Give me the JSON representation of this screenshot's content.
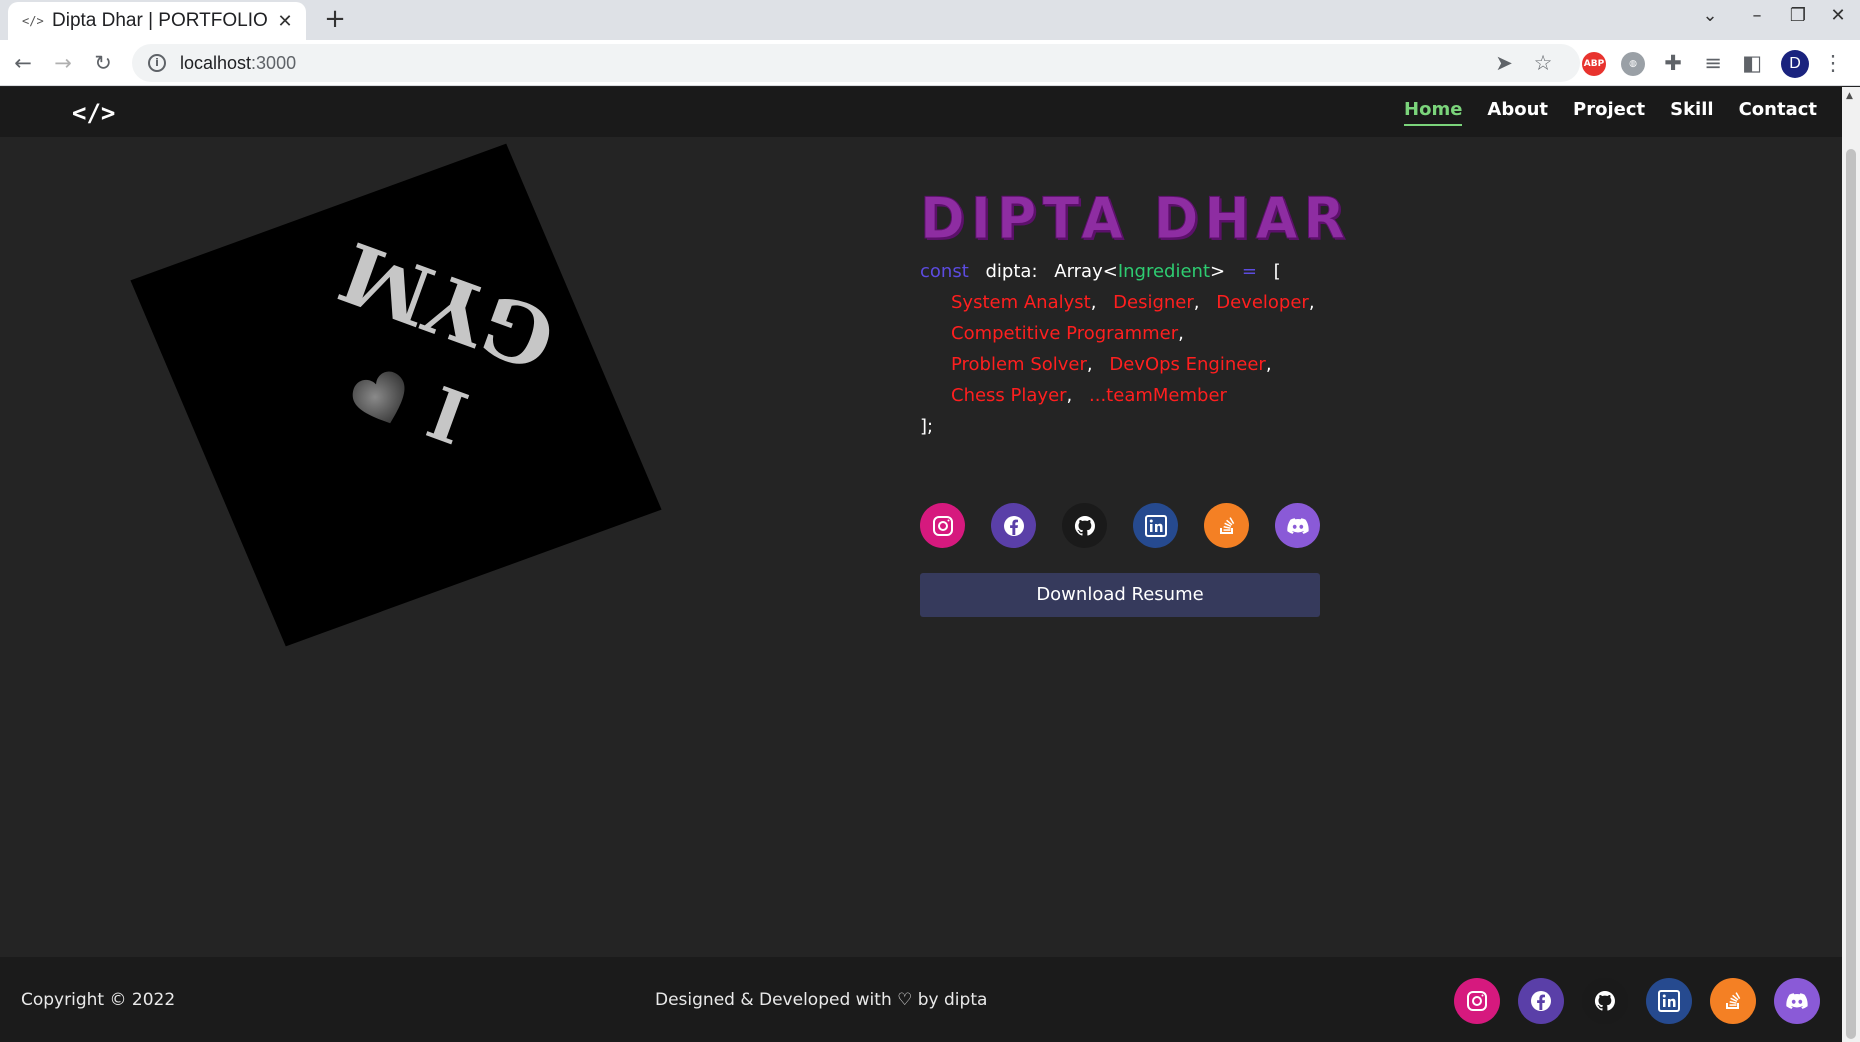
{
  "browser": {
    "tab_title": "Dipta Dhar | PORTFOLIO",
    "tab_favicon": "</>",
    "close_tab": "✕",
    "new_tab": "+",
    "url_host": "localhost",
    "url_port": ":3000",
    "profile_initial": "D",
    "ext_abp": "ABP"
  },
  "nav": {
    "logo": "</>",
    "links": [
      "Home",
      "About",
      "Project",
      "Skill",
      "Contact"
    ],
    "active": "Home"
  },
  "hero": {
    "name": "DIPTA DHAR",
    "code": {
      "keyword": "const",
      "var": "dipta:",
      "type_prefix": "Array<",
      "type_name": "Ingredient",
      "type_suffix": ">",
      "op": "=",
      "open": "[",
      "roles": [
        "System Analyst",
        "Designer",
        "Developer",
        "Competitive Programmer",
        "Problem Solver",
        "DevOps Engineer",
        "Chess Player",
        "...teamMember"
      ],
      "comma": ",",
      "close": "];"
    },
    "resume_label": "Download Resume"
  },
  "artwork": {
    "text_gym": "GYM",
    "text_i": "I"
  },
  "socials": [
    {
      "name": "instagram",
      "icon": "instagram-icon",
      "color": "#d6197e"
    },
    {
      "name": "facebook",
      "icon": "facebook-icon",
      "color": "#5a3fa8"
    },
    {
      "name": "github",
      "icon": "github-icon",
      "color": "#1a1a1a"
    },
    {
      "name": "linkedin",
      "icon": "linkedin-icon",
      "color": "#264a8f"
    },
    {
      "name": "stackoverflow",
      "icon": "stackoverflow-icon",
      "color": "#f48024"
    },
    {
      "name": "discord",
      "icon": "discord-icon",
      "color": "#8a5ad7"
    }
  ],
  "footer": {
    "copyright": "Copyright © 2022",
    "credit": "Designed & Developed with ♡ by dipta"
  },
  "colors": {
    "page_bg": "#242424",
    "nav_bg": "#1a1a1a",
    "active_link": "#7bd47b",
    "brand": "#8e2da2",
    "role": "#ff1f1f",
    "keyword": "#5c4be0",
    "type": "#2ecc71",
    "resume_bg": "#363a5c"
  }
}
